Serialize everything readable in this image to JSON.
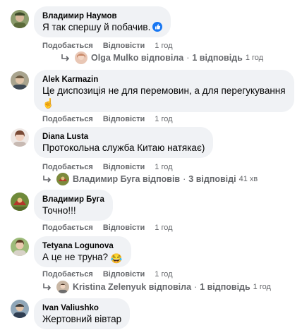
{
  "comments": [
    {
      "author": "Владимир Наумов",
      "text": "Я так спершу й побачив.",
      "like_label": "Подобається",
      "reply_label": "Відповісти",
      "time": "1 год",
      "avatar_icon": "avatar-photo-icon",
      "reaction_icon": "like-reaction-icon",
      "replies": {
        "name": "Olga Mulko",
        "verb": "відповіла",
        "count": "1 відповідь",
        "time": "1 год"
      }
    },
    {
      "author": "Alek Karmazin",
      "text_line1": "Це диспозиція не для перемовин, а для перегукування",
      "emoji": "☝",
      "like_label": "Подобається",
      "reply_label": "Відповісти",
      "time": "1 год"
    },
    {
      "author": "Diana Lusta",
      "text": "Протокольна служба Китаю натякає)",
      "like_label": "Подобається",
      "reply_label": "Відповісти",
      "time": "1 год",
      "replies": {
        "name": "Владимир Буга",
        "verb": "відповів",
        "count": "3 відповіді",
        "time": "41 хв"
      }
    },
    {
      "author": "Владимир Буга",
      "text": "Точно!!!",
      "like_label": "Подобається",
      "reply_label": "Відповісти",
      "time": "1 год"
    },
    {
      "author": "Tetyana Logunova",
      "text": "А це не труна?",
      "emoji": "😂",
      "like_label": "Подобається",
      "reply_label": "Відповісти",
      "time": "1 год",
      "replies": {
        "name": "Kristina Zelenyuk",
        "verb": "відповіла",
        "count": "1 відповідь",
        "time": "1 год"
      }
    },
    {
      "author": "Ivan Valiushko",
      "text": "Жертовний вівтар"
    }
  ],
  "separator": "·",
  "colors": {
    "bubble": "#f0f2f5",
    "meta_text": "#65676b",
    "like_blue": "#1877f2"
  }
}
